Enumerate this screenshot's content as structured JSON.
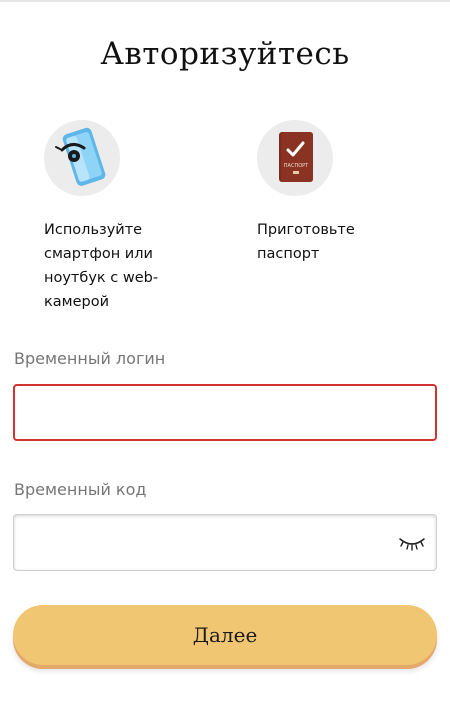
{
  "page": {
    "title": "Авторизуйтесь"
  },
  "hints": [
    {
      "icon": "smartphone-camera-icon",
      "text": "Используйте смартфон или ноутбук с web-камерой"
    },
    {
      "icon": "passport-icon",
      "text": "Приготовьте паспорт",
      "icon_text": "ПАСПОРТ"
    }
  ],
  "form": {
    "login_label": "Временный логин",
    "login_value": "",
    "code_label": "Временный код",
    "code_value": "",
    "password_toggle_icon": "closed-eye-icon"
  },
  "actions": {
    "next_label": "Далее"
  },
  "colors": {
    "accent": "#f0c673",
    "error_border": "#d1332e",
    "label": "#767676"
  }
}
